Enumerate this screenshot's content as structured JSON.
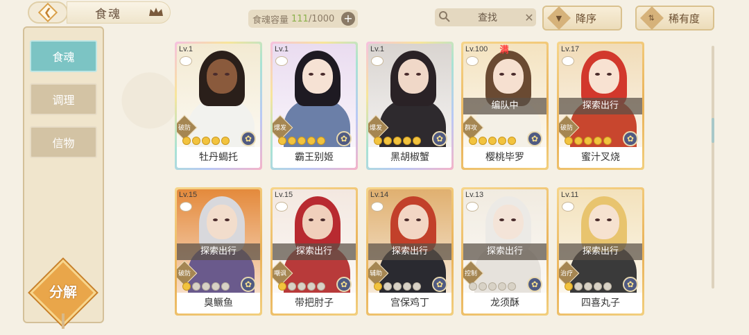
{
  "header": {
    "title": "食魂",
    "capacity_label": "食魂容量",
    "capacity_current": "111",
    "capacity_total": "/1000",
    "search_label": "查找",
    "sort_order_label": "降序",
    "sort_key_label": "稀有度"
  },
  "sidebar": {
    "items": [
      {
        "label": "食魂",
        "active": true
      },
      {
        "label": "调理",
        "active": false
      },
      {
        "label": "信物",
        "active": false
      }
    ],
    "decompose_label": "分解"
  },
  "cards": [
    {
      "level": "Lv.1",
      "name": "牡丹蝎托",
      "role": "破防",
      "stars": 5,
      "filled": 5,
      "frame": "rainbow",
      "status": "",
      "max": "",
      "hair": "#2a1f1a",
      "skin": "#8a5a3c",
      "body": "#f2f2ee",
      "bg": "#f3ead2"
    },
    {
      "level": "Lv.1",
      "name": "霸王别姬",
      "role": "爆发",
      "stars": 5,
      "filled": 5,
      "frame": "rainbow",
      "status": "",
      "max": "",
      "hair": "#1e1a22",
      "skin": "#f6e2d4",
      "body": "#6b7fa8",
      "bg": "#eadcf0"
    },
    {
      "level": "Lv.1",
      "name": "黑胡椒蟹",
      "role": "爆发",
      "stars": 5,
      "filled": 5,
      "frame": "rainbow",
      "status": "",
      "max": "",
      "hair": "#2a2226",
      "skin": "#f0d8c8",
      "body": "#2e2a2e",
      "bg": "#d9d4d0"
    },
    {
      "level": "Lv.100",
      "name": "樱桃毕罗",
      "role": "群攻",
      "stars": 5,
      "filled": 5,
      "frame": "gold",
      "status": "编队中",
      "max": "满",
      "hair": "#6a4a32",
      "skin": "#f6e0d0",
      "body": "#f4f0e6",
      "bg": "#f4e3c0"
    },
    {
      "level": "Lv.17",
      "name": "蜜汁叉烧",
      "role": "破防",
      "stars": 5,
      "filled": 5,
      "frame": "gold",
      "status": "探索出行",
      "max": "",
      "hair": "#d2382c",
      "skin": "#f8e2d2",
      "body": "#c8462e",
      "bg": "#f1dcb8"
    },
    {
      "level": "Lv.15",
      "name": "臭鳜鱼",
      "role": "破防",
      "stars": 5,
      "filled": 1,
      "frame": "gold",
      "status": "探索出行",
      "max": "",
      "hair": "#d8d8dc",
      "skin": "#f2ddcc",
      "body": "#6a5a8c",
      "bg": "#e48a3c"
    },
    {
      "level": "Lv.15",
      "name": "带把肘子",
      "role": "嘲讽",
      "stars": 5,
      "filled": 1,
      "frame": "gold",
      "status": "探索出行",
      "max": "",
      "hair": "#b82a30",
      "skin": "#f0d0bc",
      "body": "#b83a3a",
      "bg": "#f3e8e0"
    },
    {
      "level": "Lv.14",
      "name": "宫保鸡丁",
      "role": "辅助",
      "stars": 5,
      "filled": 1,
      "frame": "gold",
      "status": "探索出行",
      "max": "",
      "hair": "#c2402a",
      "skin": "#f2d6c4",
      "body": "#2a2a30",
      "bg": "#e0b070"
    },
    {
      "level": "Lv.13",
      "name": "龙须酥",
      "role": "控制",
      "stars": 5,
      "filled": 0,
      "frame": "gold",
      "status": "探索出行",
      "max": "",
      "hair": "#eceae6",
      "skin": "#f4e4d8",
      "body": "#e6e2dc",
      "bg": "#f1ebe0"
    },
    {
      "level": "Lv.11",
      "name": "四喜丸子",
      "role": "治疗",
      "stars": 5,
      "filled": 1,
      "frame": "gold",
      "status": "探索出行",
      "max": "",
      "hair": "#e8c46e",
      "skin": "#f6e2d0",
      "body": "#3a3a3a",
      "bg": "#f3e2bc"
    }
  ]
}
